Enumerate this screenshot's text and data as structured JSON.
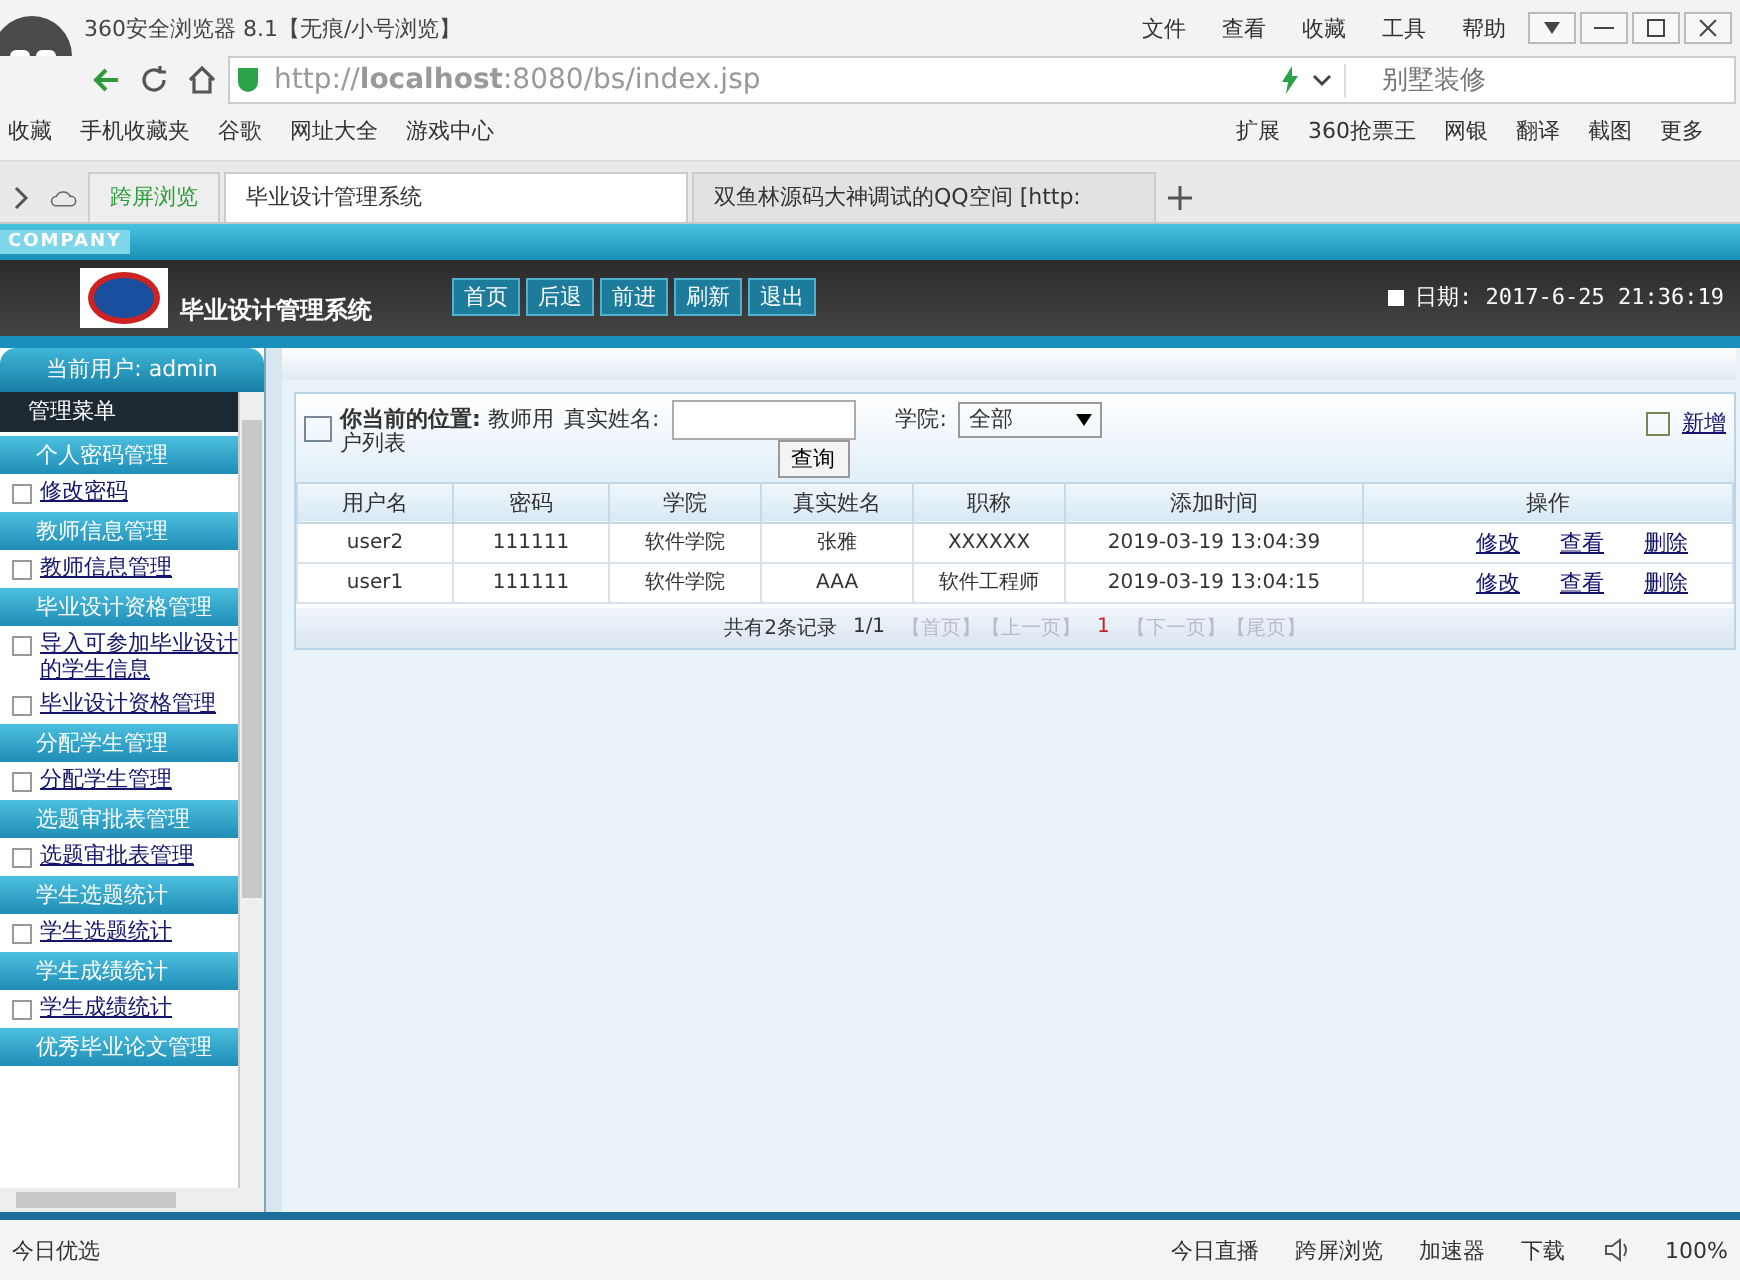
{
  "browser": {
    "title": "360安全浏览器 8.1【无痕/小号浏览】",
    "menu": [
      "文件",
      "查看",
      "收藏",
      "工具",
      "帮助"
    ],
    "url": "http://**localhost**:8080/bs/index.jsp",
    "search": {
      "placeholder": "别墅装修"
    },
    "bookmarks": [
      "收藏",
      "手机收藏夹",
      "谷歌",
      "网址大全",
      "游戏中心"
    ],
    "extensions": [
      "扩展",
      "360抢票王",
      "网银",
      "翻译",
      "截图",
      "更多"
    ],
    "tabs": [
      {
        "label": "跨屏浏览",
        "kind": "cross",
        "selected": false
      },
      {
        "label": "毕业设计管理系统",
        "kind": "page",
        "selected": true
      },
      {
        "label": "双鱼林源码大神调试的QQ空间 [http:",
        "kind": "page",
        "selected": false
      }
    ]
  },
  "header": {
    "company": "COMPANY",
    "title": "毕业设计管理系统",
    "nav": [
      "首页",
      "后退",
      "前进",
      "刷新",
      "退出"
    ],
    "date": "日期: 2017-6-25 21:36:19"
  },
  "sidebar": {
    "user": "当前用户: admin",
    "menu_title": "管理菜单",
    "groups": [
      {
        "label": "个人密码管理",
        "children": [
          "修改密码"
        ]
      },
      {
        "label": "教师信息管理",
        "children": [
          "教师信息管理"
        ]
      },
      {
        "label": "毕业设计资格管理",
        "children": [
          "导入可参加毕业设计的学生信息",
          "毕业设计资格管理"
        ]
      },
      {
        "label": "分配学生管理",
        "children": [
          "分配学生管理"
        ]
      },
      {
        "label": "选题审批表管理",
        "children": [
          "选题审批表管理"
        ]
      },
      {
        "label": "学生选题统计",
        "children": [
          "学生选题统计"
        ]
      },
      {
        "label": "学生成绩统计",
        "children": [
          "学生成绩统计"
        ]
      },
      {
        "label": "优秀毕业论文管理"
      }
    ]
  },
  "main": {
    "location": "**你当前的位置:** 教师用户列表",
    "name_label": "真实姓名:",
    "college_label": "学院:",
    "college_value": "全部",
    "query_button": "查询",
    "add_link": "新增",
    "table": {
      "columns": [
        "用户名",
        "密码",
        "学院",
        "真实姓名",
        "职称",
        "添加时间",
        "操作"
      ],
      "rows": [
        {
          "cells": [
            "user2",
            "111111",
            "软件学院",
            "张雅",
            "XXXXXX",
            "2019-03-19 13:04:39"
          ],
          "actions": [
            "修改",
            "查看",
            "删除"
          ]
        },
        {
          "cells": [
            "user1",
            "111111",
            "软件学院",
            "AAA",
            "软件工程师",
            "2019-03-19 13:04:15"
          ],
          "actions": [
            "修改",
            "查看",
            "删除"
          ]
        }
      ]
    },
    "pagination": {
      "summary": "共有2条记录",
      "page": "1/1",
      "first": "【首页】",
      "prev": "【上一页】",
      "current": "1",
      "next": "【下一页】",
      "last": "【尾页】"
    }
  },
  "status_bar": {
    "left": "今日优选",
    "items": [
      "今日直播",
      "跨屏浏览",
      "加速器",
      "下载"
    ],
    "zoom": "100%"
  }
}
